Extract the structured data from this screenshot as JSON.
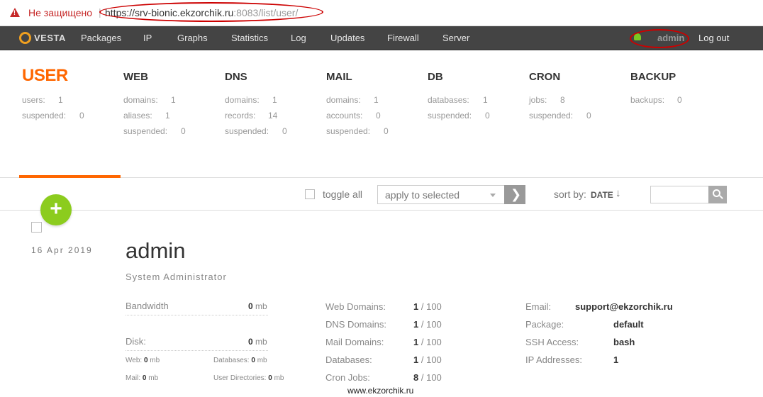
{
  "browser": {
    "insecure_label": "Не защищено",
    "separator": "|",
    "url_main": "https://srv-bionic.ekzorchik.ru",
    "url_port_path": ":8083/list/user/"
  },
  "nav": {
    "logo_text": "VESTA",
    "items": [
      "Packages",
      "IP",
      "Graphs",
      "Statistics",
      "Log",
      "Updates",
      "Firewall",
      "Server"
    ],
    "username": "admin",
    "logout": "Log out"
  },
  "stats": {
    "user": {
      "title": "USER",
      "rows": [
        [
          "users:",
          "1"
        ],
        [
          "suspended:",
          "0"
        ]
      ]
    },
    "web": {
      "title": "WEB",
      "rows": [
        [
          "domains:",
          "1"
        ],
        [
          "aliases:",
          "1"
        ],
        [
          "suspended:",
          "0"
        ]
      ]
    },
    "dns": {
      "title": "DNS",
      "rows": [
        [
          "domains:",
          "1"
        ],
        [
          "records:",
          "14"
        ],
        [
          "suspended:",
          "0"
        ]
      ]
    },
    "mail": {
      "title": "MAIL",
      "rows": [
        [
          "domains:",
          "1"
        ],
        [
          "accounts:",
          "0"
        ],
        [
          "suspended:",
          "0"
        ]
      ]
    },
    "db": {
      "title": "DB",
      "rows": [
        [
          "databases:",
          "1"
        ],
        [
          "suspended:",
          "0"
        ]
      ]
    },
    "cron": {
      "title": "CRON",
      "rows": [
        [
          "jobs:",
          "8"
        ],
        [
          "suspended:",
          "0"
        ]
      ]
    },
    "backup": {
      "title": "BACKUP",
      "rows": [
        [
          "backups:",
          "0"
        ]
      ]
    }
  },
  "toolbar": {
    "toggle_all": "toggle all",
    "apply_selected": "apply to selected",
    "apply_go": "❯",
    "sort_label": "sort by:",
    "sort_value": "DATE",
    "sort_arrow": "↓",
    "add_symbol": "+"
  },
  "user_card": {
    "date": "16 Apr 2019",
    "name": "admin",
    "role": "System Administrator",
    "bandwidth_label": "Bandwidth",
    "bandwidth_value": "0",
    "bandwidth_unit": "mb",
    "disk_label": "Disk:",
    "disk_value": "0",
    "disk_unit": "mb",
    "disk_breakdown": [
      {
        "label": "Web:",
        "value": "0",
        "unit": "mb"
      },
      {
        "label": "Databases:",
        "value": "0",
        "unit": "mb"
      },
      {
        "label": "Mail:",
        "value": "0",
        "unit": "mb"
      },
      {
        "label": "User Directories:",
        "value": "0",
        "unit": "mb"
      }
    ],
    "limits": [
      {
        "label": "Web Domains:",
        "used": "1",
        "limit": "/ 100"
      },
      {
        "label": "DNS Domains:",
        "used": "1",
        "limit": "/ 100"
      },
      {
        "label": "Mail Domains:",
        "used": "1",
        "limit": "/ 100"
      },
      {
        "label": "Databases:",
        "used": "1",
        "limit": "/ 100"
      },
      {
        "label": "Cron Jobs:",
        "used": "8",
        "limit": "/ 100"
      }
    ],
    "info": [
      {
        "label": "Email:",
        "value": "support@ekzorchik.ru"
      },
      {
        "label": "Package:",
        "value": "default"
      },
      {
        "label": "SSH Access:",
        "value": "bash"
      },
      {
        "label": "IP Addresses:",
        "value": "1"
      }
    ]
  },
  "watermark": "www.ekzorchik.ru",
  "colors": {
    "accent": "#ff6701",
    "add_button": "#8ccc1e",
    "nav_bg": "#444444",
    "annotation": "#cc0000"
  }
}
